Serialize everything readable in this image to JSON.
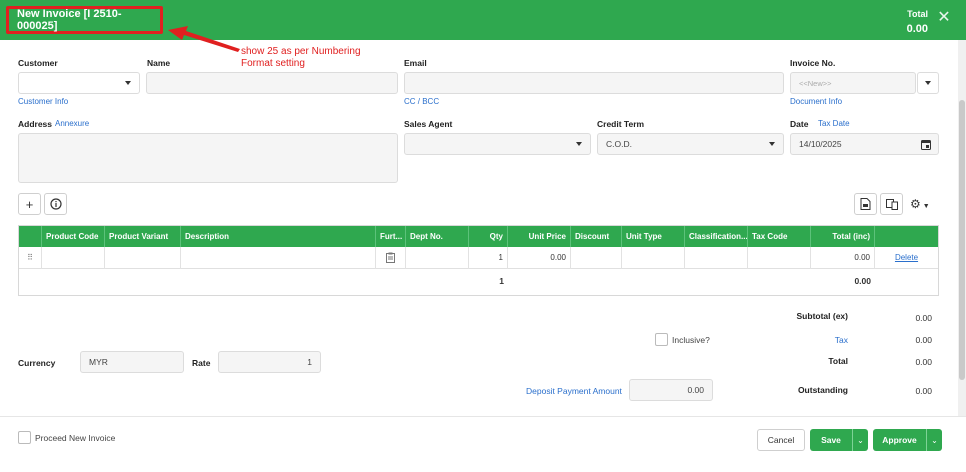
{
  "header": {
    "title": "New Invoice [I 2510-000025]",
    "total_label": "Total",
    "total_value": "0.00"
  },
  "annotation": {
    "line1": "show 25 as per Numbering",
    "line2": "Format setting"
  },
  "form": {
    "customer_label": "Customer",
    "customer_info_link": "Customer Info",
    "name_label": "Name",
    "email_label": "Email",
    "cc_bcc_link": "CC / BCC",
    "invoice_no_label": "Invoice No.",
    "invoice_no_placeholder": "<<New>>",
    "document_info_link": "Document Info",
    "address_label": "Address",
    "annexure_link": "Annexure",
    "sales_agent_label": "Sales Agent",
    "credit_term_label": "Credit Term",
    "credit_term_value": "C.O.D.",
    "date_label": "Date",
    "tax_date_link": "Tax Date",
    "date_value": "14/10/2025"
  },
  "table": {
    "headers": [
      "Product Code",
      "Product Variant",
      "Description",
      "Furt...",
      "Dept No.",
      "Qty",
      "Unit Price",
      "Discount",
      "Unit Type",
      "Classification...",
      "Tax Code",
      "Total (inc)"
    ],
    "row": {
      "qty": "1",
      "unit_price": "0.00",
      "total": "0.00",
      "delete_link": "Delete"
    },
    "footer": {
      "qty_total": "1",
      "amount_total": "0.00"
    }
  },
  "summary": {
    "subtotal_label": "Subtotal (ex)",
    "subtotal_value": "0.00",
    "inclusive_label": "Inclusive?",
    "tax_label": "Tax",
    "tax_value": "0.00",
    "total_label": "Total",
    "total_value": "0.00",
    "deposit_label": "Deposit Payment Amount",
    "deposit_value": "0.00",
    "outstanding_label": "Outstanding",
    "outstanding_value": "0.00"
  },
  "currency": {
    "currency_label": "Currency",
    "currency_value": "MYR",
    "rate_label": "Rate",
    "rate_value": "1"
  },
  "footer": {
    "proceed_label": "Proceed New Invoice",
    "cancel_label": "Cancel",
    "save_label": "Save",
    "approve_label": "Approve"
  },
  "colors": {
    "brand_green": "#2fa84f",
    "annotation_red": "#e02020",
    "link_blue": "#2a6fcc"
  }
}
